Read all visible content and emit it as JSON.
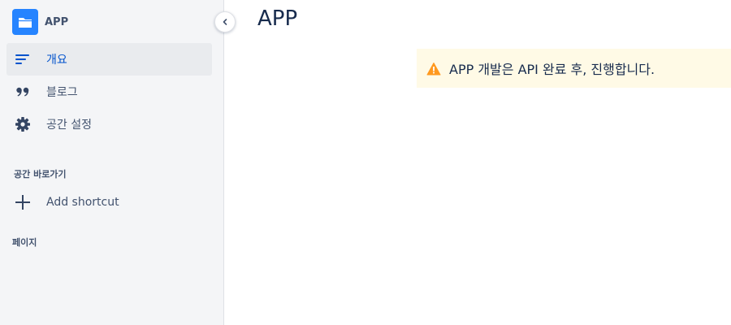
{
  "space": {
    "name": "APP",
    "logo_color": "#2684ff",
    "logo_icon": "folder-icon"
  },
  "sidebar": {
    "items": [
      {
        "label": "개요",
        "icon": "overview-icon",
        "active": true
      },
      {
        "label": "블로그",
        "icon": "quote-icon",
        "active": false
      },
      {
        "label": "공간 설정",
        "icon": "gear-icon",
        "active": false
      }
    ],
    "shortcuts_heading": "공간 바로가기",
    "add_shortcut_label": "Add shortcut",
    "pages_heading": "페이지"
  },
  "main": {
    "title": "APP",
    "warning": {
      "text": "APP 개발은 API 완료 후, 진행합니다.",
      "icon": "warning-icon",
      "background": "#fffae6",
      "icon_color": "#ff991f"
    }
  },
  "colors": {
    "sidebar_bg": "#f4f5f7",
    "active_item": "#0052cc",
    "text": "#42526e"
  }
}
